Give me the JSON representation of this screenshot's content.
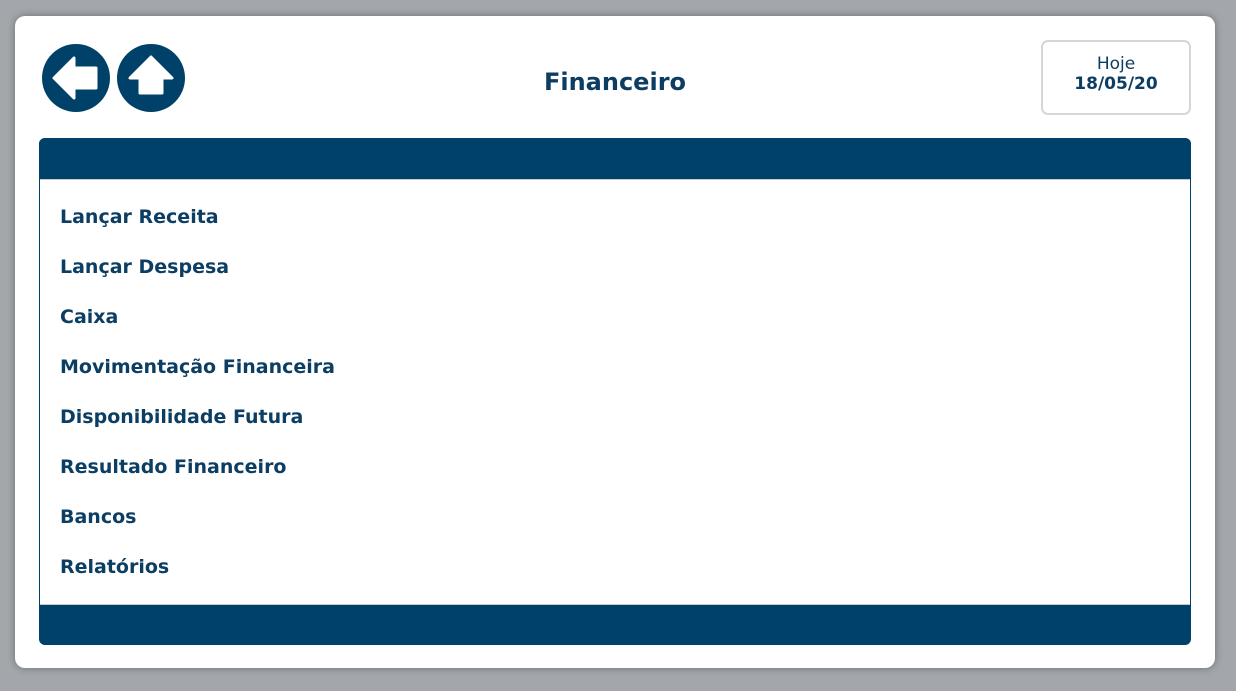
{
  "header": {
    "title": "Financeiro",
    "back_icon": "arrow-left-icon",
    "home_icon": "home-arrow-up-icon"
  },
  "date": {
    "label": "Hoje",
    "value": "18/05/20"
  },
  "menu": {
    "items": [
      {
        "label": "Lançar Receita"
      },
      {
        "label": "Lançar Despesa"
      },
      {
        "label": "Caixa"
      },
      {
        "label": "Movimentação Financeira"
      },
      {
        "label": "Disponibilidade Futura"
      },
      {
        "label": "Resultado Financeiro"
      },
      {
        "label": "Bancos"
      },
      {
        "label": "Relatórios"
      }
    ]
  },
  "colors": {
    "primary": "#004169",
    "text": "#0c3e63",
    "background": "#a3a7ab"
  }
}
